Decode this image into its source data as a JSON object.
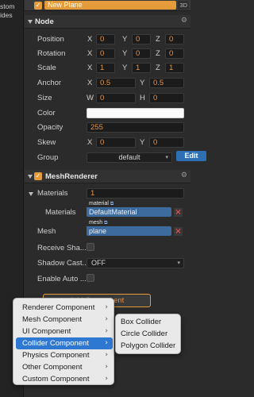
{
  "left_panel": {
    "text": "stom\nides"
  },
  "node": {
    "name": "New Plane",
    "badge": "3D",
    "active": true
  },
  "node_section": {
    "title": "Node",
    "position": {
      "label": "Position",
      "x": "0",
      "y": "0",
      "z": "0"
    },
    "rotation": {
      "label": "Rotation",
      "x": "0",
      "y": "0",
      "z": "0"
    },
    "scale": {
      "label": "Scale",
      "x": "1",
      "y": "1",
      "z": "1"
    },
    "anchor": {
      "label": "Anchor",
      "x": "0.5",
      "y": "0.5"
    },
    "size": {
      "label": "Size",
      "w": "0",
      "h": "0"
    },
    "color": {
      "label": "Color",
      "value": "#ffffff"
    },
    "opacity": {
      "label": "Opacity",
      "value": "255"
    },
    "skew": {
      "label": "Skew",
      "x": "0",
      "y": "0"
    },
    "group": {
      "label": "Group",
      "value": "default",
      "edit": "Edit"
    }
  },
  "axes": {
    "x": "X",
    "y": "Y",
    "z": "Z",
    "w": "W",
    "h": "H"
  },
  "mesh_renderer": {
    "title": "MeshRenderer",
    "enabled": true,
    "materials_group_label": "Materials",
    "materials_count": "1",
    "materials_label": "Materials",
    "material_tag": "material",
    "material_value": "DefaultMaterial",
    "mesh_label": "Mesh",
    "mesh_tag": "mesh",
    "mesh_value": "plane",
    "receive_shadows_label": "Receive Sha...",
    "shadow_casting_label": "Shadow Cast...",
    "shadow_casting_value": "OFF",
    "enable_auto_label": "Enable Auto ..."
  },
  "add_component_button": "Add Component",
  "menu": {
    "items": [
      {
        "label": "Renderer Component"
      },
      {
        "label": "Mesh Component"
      },
      {
        "label": "UI Component"
      },
      {
        "label": "Collider Component"
      },
      {
        "label": "Physics Component"
      },
      {
        "label": "Other Component"
      },
      {
        "label": "Custom Component"
      }
    ],
    "active_index": 3
  },
  "submenu": {
    "items": [
      "Box Collider",
      "Circle Collider",
      "Polygon Collider"
    ]
  },
  "colors": {
    "accent": "#e69b3a",
    "value_text": "#e6924a",
    "asset_blue": "#3d6b9e",
    "menu_highlight": "#2f78d2"
  }
}
